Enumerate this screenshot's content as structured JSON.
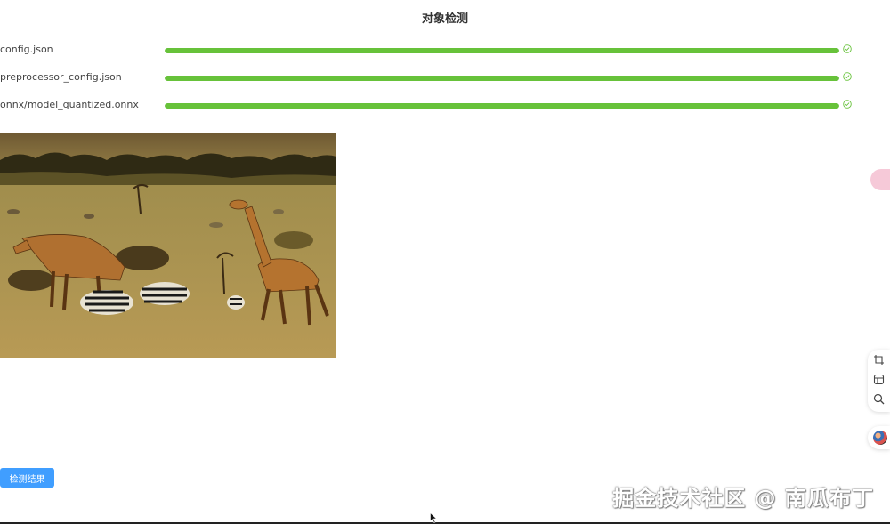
{
  "page": {
    "title": "对象检测"
  },
  "files": [
    {
      "name": "config.json",
      "progress_percent": 100,
      "status": "success"
    },
    {
      "name": "preprocessor_config.json",
      "progress_percent": 100,
      "status": "success"
    },
    {
      "name": "onnx/model_quantized.onnx",
      "progress_percent": 100,
      "status": "success"
    }
  ],
  "image": {
    "subject": "giraffes and zebras grazing on savanna",
    "icon": "photo"
  },
  "actions": {
    "detect_result_label": "检测结果"
  },
  "sidebar_tools": {
    "icons": [
      "crop-icon",
      "template-icon",
      "search-icon",
      "avatar"
    ]
  },
  "watermark": {
    "text": "掘金技术社区 @ 南瓜布丁"
  },
  "colors": {
    "progress": "#67c23a",
    "button": "#409eff"
  }
}
